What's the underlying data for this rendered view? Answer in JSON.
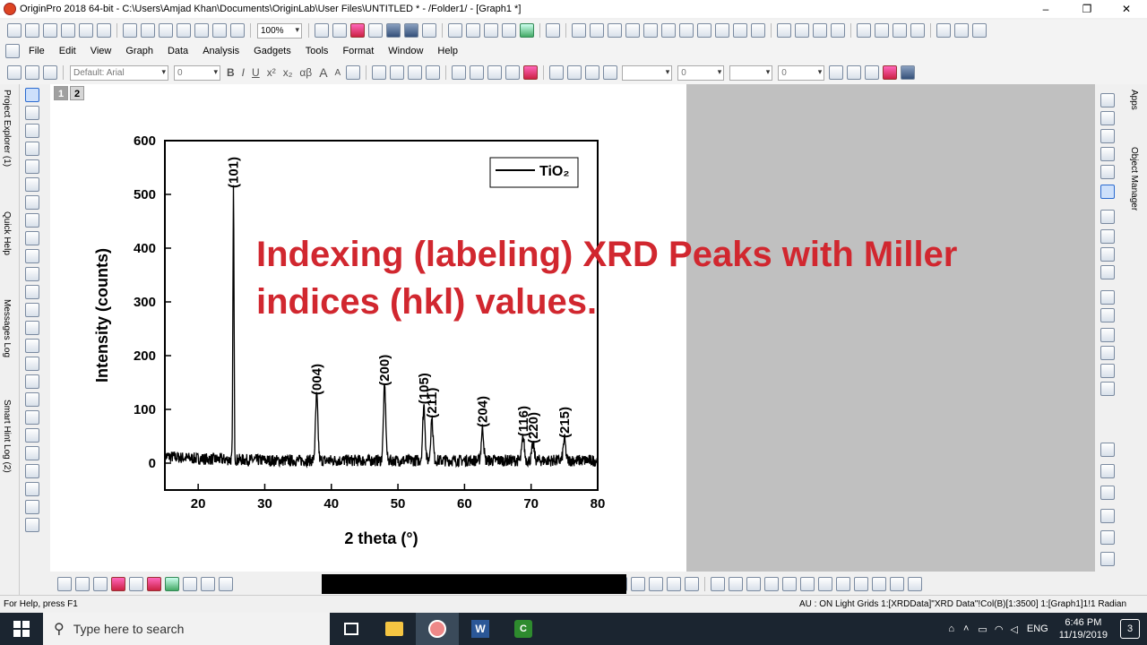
{
  "window": {
    "title": "OriginPro 2018 64-bit - C:\\Users\\Amjad Khan\\Documents\\OriginLab\\User Files\\UNTITLED * - /Folder1/ - [Graph1 *]",
    "minimize": "–",
    "restore": "❐",
    "close": "✕"
  },
  "toolbar1": {
    "zoom": "100%"
  },
  "menu": [
    "File",
    "Edit",
    "View",
    "Graph",
    "Data",
    "Analysis",
    "Gadgets",
    "Tools",
    "Format",
    "Window",
    "Help"
  ],
  "format_toolbar": {
    "font": "Default: Arial",
    "font_size": "0",
    "bold": "B",
    "italic": "I",
    "underline": "U",
    "superscript": "x²",
    "subscript": "x₂",
    "greek": "αβ",
    "grow": "A",
    "shrink": "A",
    "line_width": "0",
    "line_width2": "0"
  },
  "left_tabs": {
    "project_explorer": "Project Explorer (1)",
    "quick_help": "Quick Help",
    "messages_log": "Messages Log",
    "smart_hint": "Smart Hint Log (2)"
  },
  "right_tabs": {
    "apps": "Apps",
    "object_manager": "Object Manager"
  },
  "page_tabs": [
    "1",
    "2"
  ],
  "overlay_title": {
    "line1": "Indexing (labeling) XRD Peaks with Miller",
    "line2": "indices (hkl)  values."
  },
  "chart_data": {
    "type": "line",
    "xlabel": "2 theta (°)",
    "ylabel": "Intensity (counts)",
    "xlim": [
      15,
      80
    ],
    "ylim": [
      -50,
      600
    ],
    "x_ticks": [
      20,
      30,
      40,
      50,
      60,
      70,
      80
    ],
    "y_ticks": [
      0,
      100,
      200,
      300,
      400,
      500,
      600
    ],
    "legend": "TiO₂",
    "legend_placement": "top-right",
    "color": "#000000",
    "peaks": [
      {
        "x": 25.3,
        "y": 510,
        "label": "(101)"
      },
      {
        "x": 37.8,
        "y": 125,
        "label": "(004)"
      },
      {
        "x": 48.0,
        "y": 142,
        "label": "(200)"
      },
      {
        "x": 53.9,
        "y": 108,
        "label": "(105)"
      },
      {
        "x": 55.1,
        "y": 82,
        "label": "(211)"
      },
      {
        "x": 62.7,
        "y": 65,
        "label": "(204)"
      },
      {
        "x": 68.8,
        "y": 48,
        "label": "(116)"
      },
      {
        "x": 70.3,
        "y": 35,
        "label": "(220)"
      },
      {
        "x": 75.0,
        "y": 45,
        "label": "(215)"
      }
    ]
  },
  "status": {
    "left": "For Help, press F1",
    "right": "AU : ON  Light Grids  1:[XRDData]\"XRD Data\"!Col(B)[1:3500]  1:[Graph1]1!1  Radian"
  },
  "taskbar": {
    "search_placeholder": "Type here to search",
    "lang": "ENG",
    "time": "6:46 PM",
    "date": "11/19/2019",
    "notif": "3"
  }
}
